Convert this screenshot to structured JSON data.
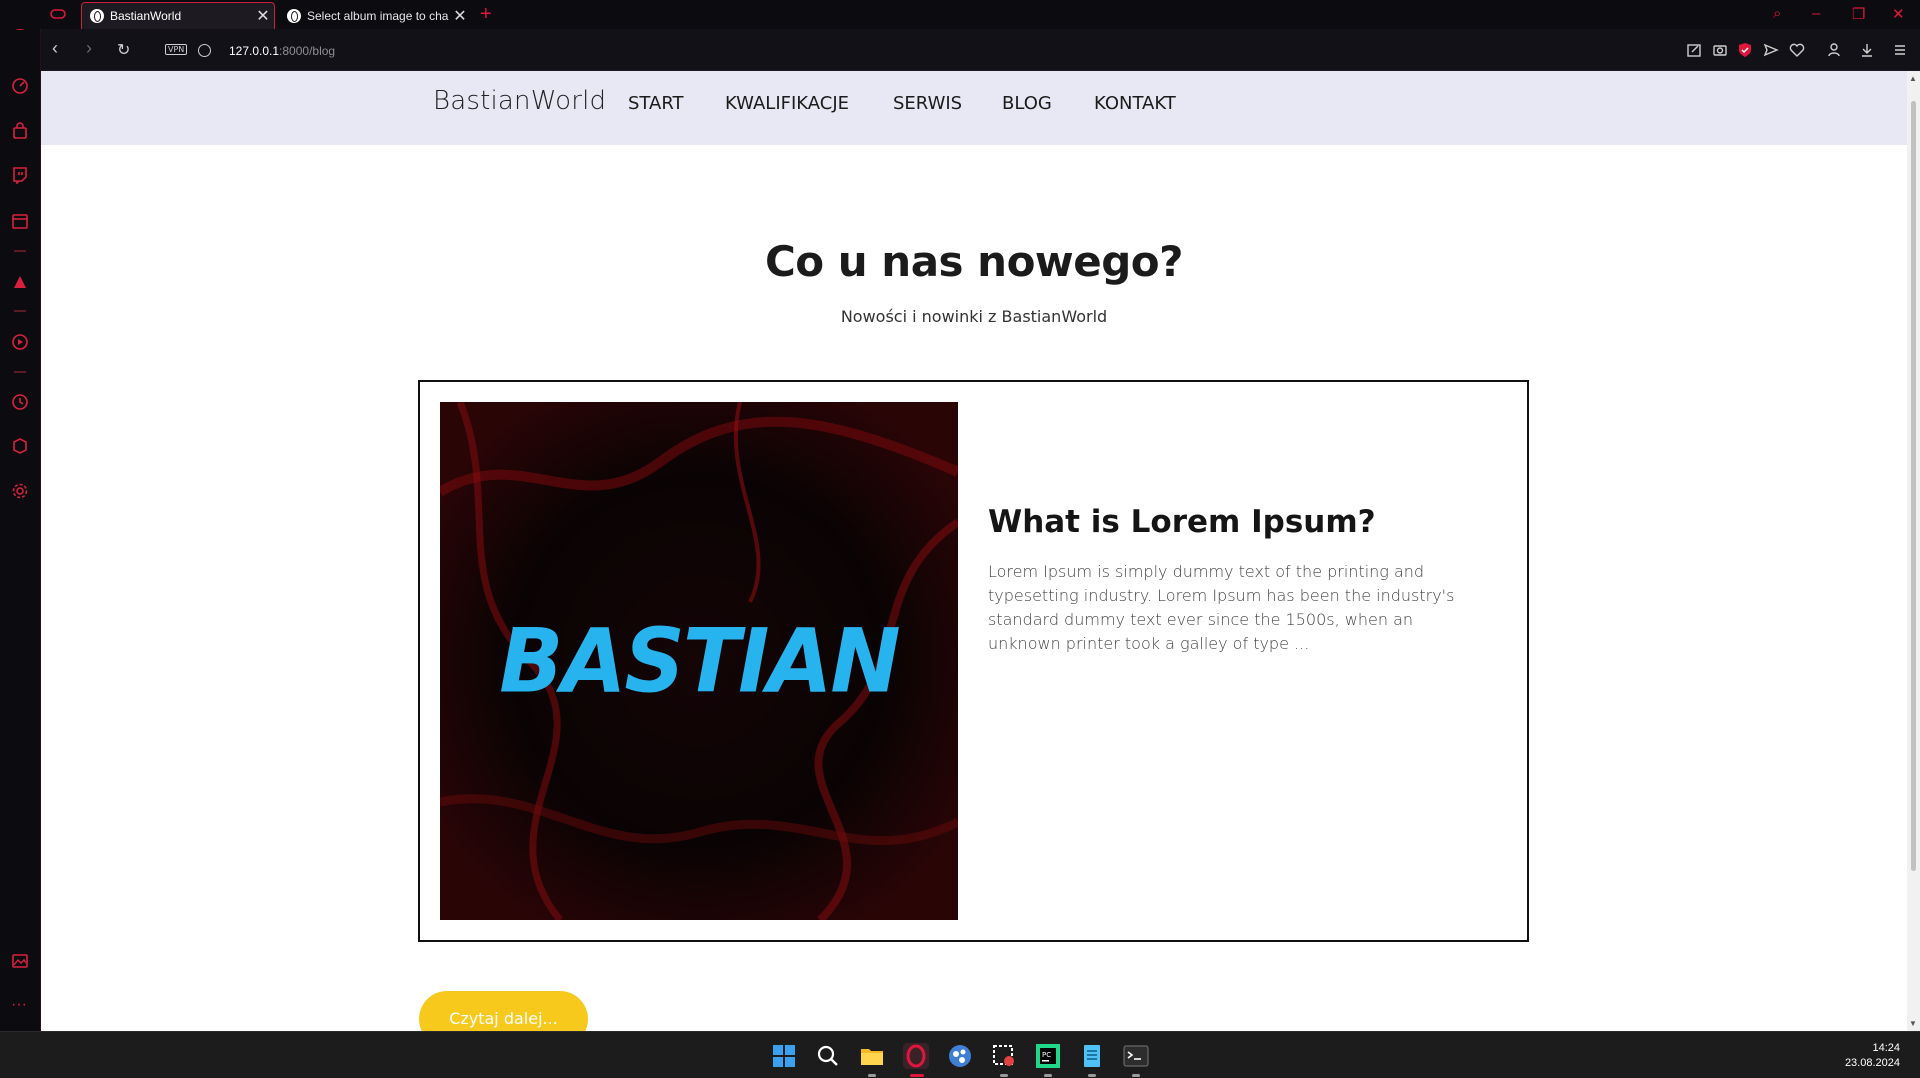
{
  "browser": {
    "tabs": [
      {
        "title": "BastianWorld",
        "active": true
      },
      {
        "title": "Select album image to cha",
        "active": false
      }
    ],
    "url_host": "127.0.0.1",
    "url_rest": ":8000/blog",
    "vpn_label": "VPN",
    "accent_color": "#e0163b"
  },
  "site": {
    "brand": "BastianWorld",
    "nav": [
      "START",
      "KWALIFIKACJE",
      "SERWIS",
      "BLOG",
      "KONTAKT"
    ],
    "heading": "Co u nas nowego?",
    "subheading": "Nowości i nowinki z BastianWorld",
    "post": {
      "image_text": "BASTIAN",
      "title": "What is Lorem Ipsum?",
      "excerpt": "Lorem Ipsum is simply dummy text of the printing and typesetting industry. Lorem Ipsum has been the industry's standard dummy text ever since the 1500s, when an unknown printer took a galley of type ..."
    },
    "read_more": "Czytaj dalej...",
    "button_color": "#f7c91c"
  },
  "taskbar": {
    "time": "14:24",
    "date": "23.08.2024"
  }
}
